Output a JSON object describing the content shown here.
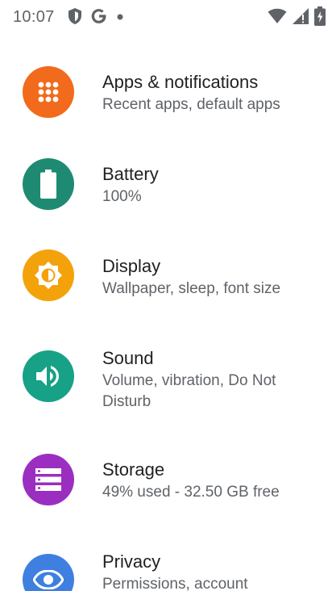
{
  "status_bar": {
    "time": "10:07",
    "icons": [
      "shield-notification-icon",
      "google-icon",
      "dot-icon",
      "wifi-icon",
      "signal-icon",
      "battery-icon"
    ]
  },
  "settings": {
    "items": [
      {
        "title": "Apps & notifications",
        "subtitle": "Recent apps, default apps",
        "icon": "apps-grid-icon",
        "color": "#F26A1B"
      },
      {
        "title": "Battery",
        "subtitle": "100%",
        "icon": "battery-icon",
        "color": "#1E8A72"
      },
      {
        "title": "Display",
        "subtitle": "Wallpaper, sleep, font size",
        "icon": "brightness-icon",
        "color": "#F4A20C"
      },
      {
        "title": "Sound",
        "subtitle": "Volume, vibration, Do Not Disturb",
        "icon": "volume-icon",
        "color": "#17A186"
      },
      {
        "title": "Storage",
        "subtitle": "49% used - 32.50 GB free",
        "icon": "storage-icon",
        "color": "#9B2EC0"
      },
      {
        "title": "Privacy",
        "subtitle": "Permissions, account",
        "icon": "eye-icon",
        "color": "#3F7FE0"
      }
    ]
  }
}
